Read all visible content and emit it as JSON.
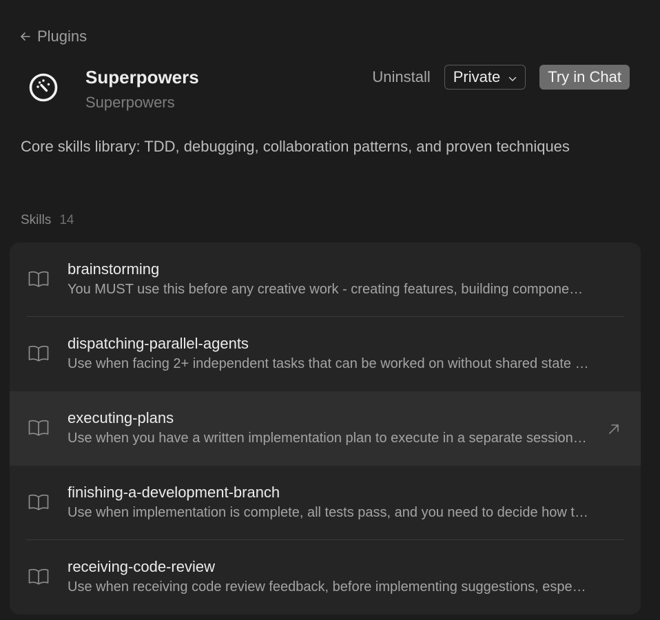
{
  "nav": {
    "back_label": "Plugins"
  },
  "plugin": {
    "icon": "gauge-icon",
    "title": "Superpowers",
    "subtitle": "Superpowers",
    "description": "Core skills library: TDD, debugging, collaboration patterns, and proven techniques"
  },
  "actions": {
    "uninstall_label": "Uninstall",
    "visibility_value": "Private",
    "try_label": "Try in Chat"
  },
  "skills": {
    "heading": "Skills",
    "count": "14",
    "items": [
      {
        "name": "brainstorming",
        "description": "You MUST use this before any creative work - creating features, building components, adding functionality, or modifying behavior"
      },
      {
        "name": "dispatching-parallel-agents",
        "description": "Use when facing 2+ independent tasks that can be worked on without shared state or sequential dependencies"
      },
      {
        "name": "executing-plans",
        "description": "Use when you have a written implementation plan to execute in a separate session with review checkpoints"
      },
      {
        "name": "finishing-a-development-branch",
        "description": "Use when implementation is complete, all tests pass, and you need to decide how to integrate the work"
      },
      {
        "name": "receiving-code-review",
        "description": "Use when receiving code review feedback, before implementing suggestions, especially if feedback seems unclear"
      }
    ]
  },
  "colors": {
    "background": "#1c1c1c",
    "panel": "#252525",
    "hover_row": "#2f2f2f",
    "try_button": "#6c6c6c"
  }
}
